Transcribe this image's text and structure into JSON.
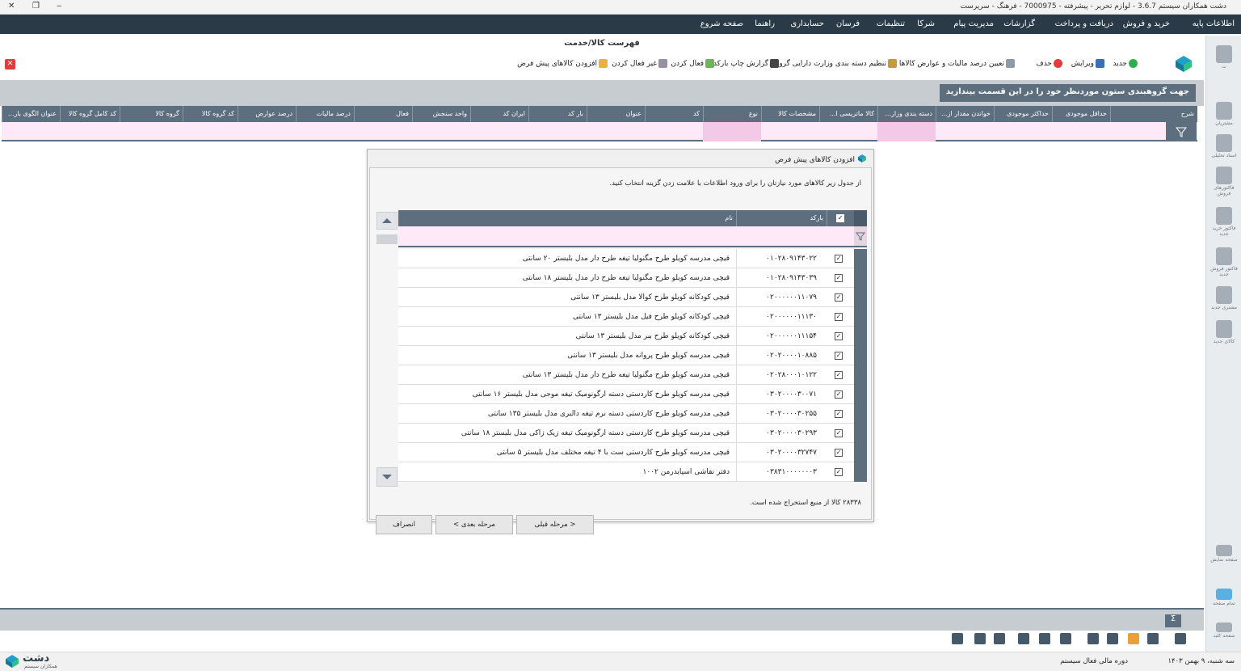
{
  "window": {
    "title": "دشت همکاران سیستم 3.6.7 - لوازم تحریر - پیشرفته - 7000975 - فرهنگ - سرپرست",
    "controls": [
      "✕",
      "❐",
      "‒"
    ]
  },
  "menu": [
    "اطلاعات پایه",
    "خرید و فروش",
    "دریافت و پرداخت",
    "گزارشات",
    "مدیریت پیام",
    "شرکا",
    "تنظیمات",
    "فرسان",
    "حسابداری",
    "راهنما",
    "صفحه شروع"
  ],
  "document": {
    "title": "فهرست کالا/خدمت"
  },
  "toolbar": {
    "new": "جدید",
    "edit": "ویرایش",
    "delete": "حذف",
    "tax": "تعیین درصد مالیات و عوارض کالاها",
    "ministry": "تنظیم دسته بندی وزارت دارایی گروهی",
    "barcode": "گزارش چاپ بارکد",
    "activate": "فعال کردن",
    "deactivate": "غیر فعال کردن",
    "default_goods": "افزودن کالاهای پیش فرض"
  },
  "group_hint": "جهت گروهبندی ستون موردنظر خود را در این قسمت بیندازید",
  "grid": {
    "columns": [
      "شرح",
      "حداقل موجودی",
      "حداکثر موجودی",
      "خواندن مقدار از...",
      "دسته بندی وزار...",
      "کالا ماتریسی ا...",
      "مشخصات کالا",
      "نوع",
      "کد",
      "عنوان",
      "بار کد",
      "ایران کد",
      "واحد سنجش",
      "فعال",
      "درصد مالیات",
      "درصد عوارض",
      "کد گروه کالا",
      "گروه کالا",
      "کد کامل گروه کالا",
      "عنوان الگوی بار..."
    ]
  },
  "dialog": {
    "title": "افزودن کالاهای پیش فرض",
    "instruction": "از جدول زیر کالاهای مورد نیازتان را برای ورود اطلاعات با علامت زدن گزینه انتخاب کنید.",
    "col_barcode": "بارکد",
    "col_name": "نام",
    "rows": [
      {
        "barcode": "۰۱۰۲۸۰۹۱۴۳۰۲۲",
        "name": "قیچی مدرسه کویلو طرح مگنولیا تیغه طرح دار مدل بلیستر ۲۰ سانتی"
      },
      {
        "barcode": "۰۱۰۲۸۰۹۱۴۳۰۳۹",
        "name": "قیچی مدرسه کویلو طرح مگنولیا تیغه طرح دار مدل بلیستر ۱۸ سانتی"
      },
      {
        "barcode": "۰۲۰۰۰۰۰۰۱۱۰۷۹",
        "name": "قیچی کودکانه کویلو طرح کوالا مدل بلیستر ۱۳ سانتی"
      },
      {
        "barcode": "۰۲۰۰۰۰۰۰۱۱۱۳۰",
        "name": "قیچی کودکانه کویلو طرح فیل مدل بلیستر ۱۳ سانتی"
      },
      {
        "barcode": "۰۲۰۰۰۰۰۰۱۱۱۵۴",
        "name": "قیچی کودکانه کویلو طرح ببر مدل بلیستر ۱۳ سانتی"
      },
      {
        "barcode": "۰۲۰۲۰۰۰۰۱۰۸۸۵",
        "name": "قیچی مدرسه کویلو طرح پروانه مدل بلیستر ۱۳ سانتی"
      },
      {
        "barcode": "۰۲۰۲۸۰۰۰۱۰۱۲۲",
        "name": "قیچی مدرسه کویلو طرح مگنولیا تیغه طرح دار مدل بلیستر ۱۳ سانتی"
      },
      {
        "barcode": "۰۳۰۲۰۰۰۰۳۰۰۷۱",
        "name": "قیچی مدرسه کویلو طرح کاردستی دسته ارگونومیک تیغه موجی مدل بلیستر ۱۶ سانتی"
      },
      {
        "barcode": "۰۳۰۲۰۰۰۰۳۰۲۵۵",
        "name": "قیچی مدرسه کویلو طرح کاردستی دسته نرم تیغه دالبری مدل بلیستر ۱۳۵ سانتی"
      },
      {
        "barcode": "۰۳۰۲۰۰۰۰۳۰۲۹۳",
        "name": "قیچی مدرسه کویلو طرح کاردستی دسته ارگونومیک تیغه زیک زاکی مدل بلیستر ۱۸ سانتی"
      },
      {
        "barcode": "۰۳۰۲۰۰۰۰۳۲۷۴۷",
        "name": "قیچی مدرسه کویلو طرح کاردستی ست با ۴ تیغه مختلف مدل بلیستر ۵ سانتی"
      },
      {
        "barcode": "۰۳۸۳۱۰۰۰۰۰۰۰۳",
        "name": "دفتر نقاشی اسپایدرمن ۱۰۰۲"
      }
    ],
    "count_text": "۲۸۳۳۸ کالا از منبع استخراج شده است.",
    "btn_prev": "< مرحله قبلی",
    "btn_next": "مرحله بعدی >",
    "btn_cancel": "انصراف"
  },
  "right_panel": [
    "ت",
    "مشتریان",
    "اسناد تحلیلی",
    "فاکتورهای فروش",
    "فاکتور خرید جدید",
    "فاکتور فروش جدید",
    "مشتری جدید",
    "کالای جدید",
    "صفحه نمایش",
    "تمام صفحه",
    "صفحه کلید"
  ],
  "status": {
    "date": "سه شنبه، ۹ بهمن ۱۴۰۳",
    "fiscal": "دوره مالی فعال سیستم",
    "brand": "دشت",
    "brand_sub": "همکاران سیستم"
  },
  "colors": {
    "header": "#5d6f7e",
    "menubar": "#2b3a47",
    "filter_pink": "#fde9f8"
  }
}
